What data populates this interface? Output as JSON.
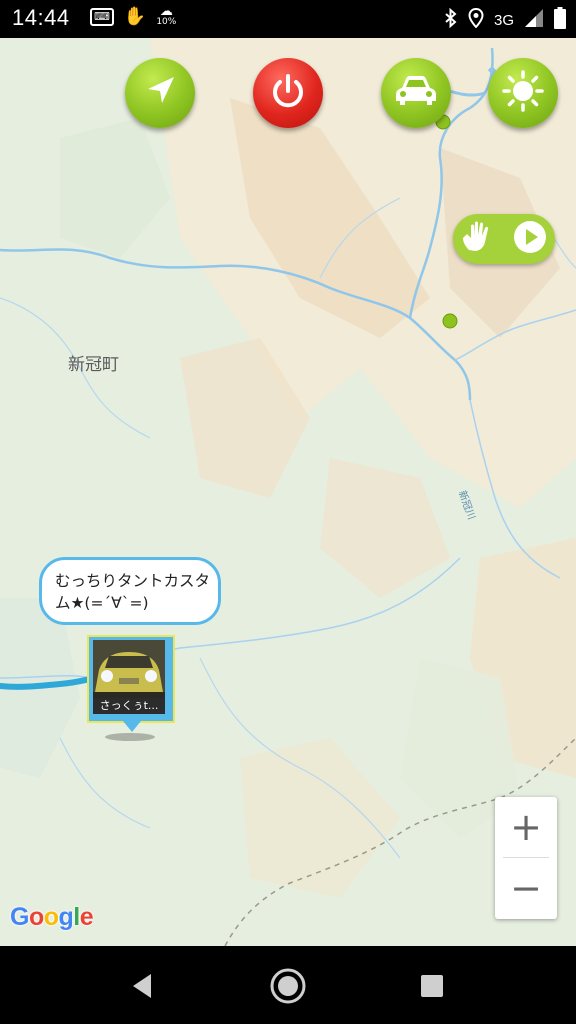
{
  "status_bar": {
    "time": "14:44",
    "left_icons": [
      "keyboard-icon",
      "hand-icon",
      "weather-icon"
    ],
    "weather_percent": "10%",
    "right_icons": [
      "bluetooth-icon",
      "location-icon",
      "signal-icon"
    ],
    "network": "3G"
  },
  "top_buttons": [
    {
      "name": "navigation-button",
      "icon": "navigation-arrow-icon",
      "color": "#8ec422"
    },
    {
      "name": "power-button",
      "icon": "power-icon",
      "color": "#e0261e"
    },
    {
      "name": "car-button",
      "icon": "car-icon",
      "color": "#8ec422"
    },
    {
      "name": "brightness-button",
      "icon": "sun-icon",
      "color": "#8ec422"
    }
  ],
  "gesture_control": {
    "icons": [
      "hand-icon",
      "play-icon"
    ],
    "color": "#a5d13a"
  },
  "map": {
    "town_label": "新冠町",
    "river_label": "新冠川",
    "attribution": "Google"
  },
  "user_marker": {
    "speech_line1": "むっちりタントカスタ",
    "speech_line2": "ム★(=´∀`=)",
    "label": "さっくぅt...",
    "accent_color": "#57b9ea"
  },
  "zoom": {
    "in_label": "+",
    "out_label": "−"
  },
  "nav_bar": {
    "buttons": [
      "back-icon",
      "home-icon",
      "recents-icon"
    ]
  }
}
